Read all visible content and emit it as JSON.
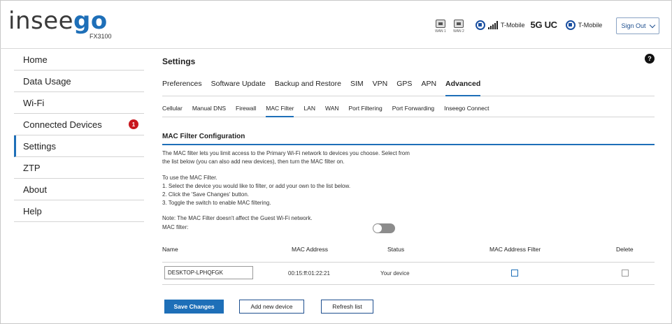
{
  "header": {
    "logo_prefix": "insee",
    "logo_suffix": "go",
    "model": "FX3100",
    "wan1": "WAN 1",
    "wan2": "WAN 2",
    "carrier1": "T-Mobile",
    "network": "5G UC",
    "carrier2": "T-Mobile",
    "sign_out": "Sign Out"
  },
  "sidebar": {
    "items": [
      {
        "label": "Home"
      },
      {
        "label": "Data Usage"
      },
      {
        "label": "Wi-Fi"
      },
      {
        "label": "Connected Devices",
        "badge": "1"
      },
      {
        "label": "Settings"
      },
      {
        "label": "ZTP"
      },
      {
        "label": "About"
      },
      {
        "label": "Help"
      }
    ]
  },
  "main": {
    "title": "Settings",
    "help": "?",
    "tabs": [
      "Preferences",
      "Software Update",
      "Backup and Restore",
      "SIM",
      "VPN",
      "GPS",
      "APN",
      "Advanced"
    ],
    "subtabs": [
      "Cellular",
      "Manual DNS",
      "Firewall",
      "MAC Filter",
      "LAN",
      "WAN",
      "Port Filtering",
      "Port Forwarding",
      "Inseego Connect"
    ],
    "section_title": "MAC Filter Configuration",
    "intro_line1": "The MAC filter lets you limit access to the Primary Wi-Fi network to devices you choose. Select from",
    "intro_line2": "the list below (you can also add new devices), then turn the MAC filter on.",
    "steps_title": "To use the MAC Filter.",
    "step1": "1. Select the device you would like to filter, or add your own to the list below.",
    "step2": "2. Click the 'Save Changes' button.",
    "step3": "3. Toggle the switch to enable MAC filtering.",
    "note": "Note: The MAC Filter doesn't affect the Guest Wi-Fi network.",
    "mac_filter_label": "MAC filter:",
    "mac_filter_enabled": false,
    "table": {
      "headers": [
        "Name",
        "MAC Address",
        "Status",
        "MAC Address Filter",
        "Delete"
      ],
      "rows": [
        {
          "name": "DESKTOP-LPHQFGK",
          "mac": "00:15:ff:01:22:21",
          "status": "Your device",
          "filter": false,
          "delete": false
        }
      ]
    },
    "buttons": {
      "save": "Save Changes",
      "add": "Add new device",
      "refresh": "Refresh list"
    }
  },
  "colors": {
    "accent": "#1e6fb8",
    "badge": "#c8161d"
  }
}
